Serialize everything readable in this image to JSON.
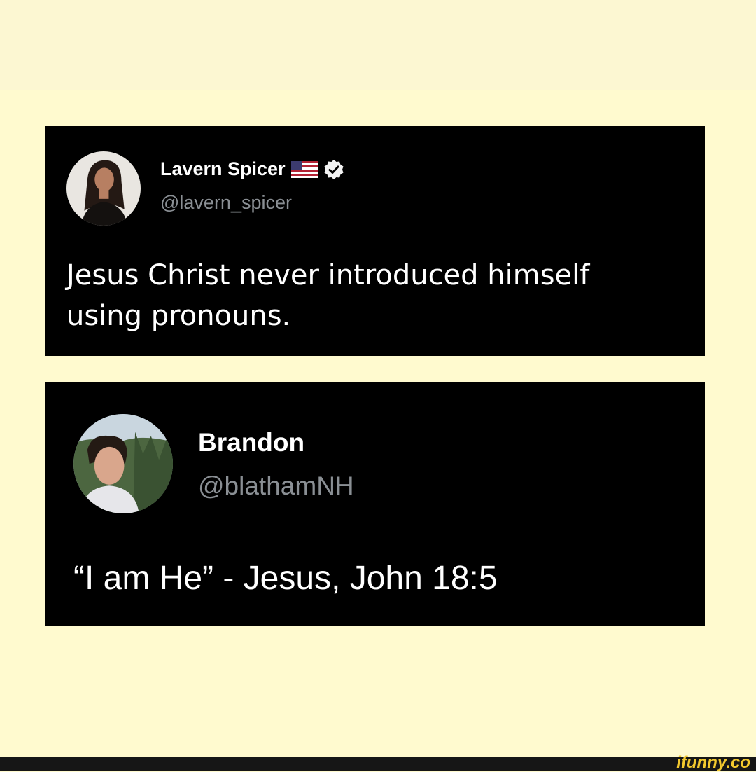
{
  "tweets": [
    {
      "display_name": "Lavern Spicer",
      "handle": "@lavern_spicer",
      "text": "Jesus Christ never introduced himself\nusing pronouns.",
      "has_flag": true,
      "verified": true
    },
    {
      "display_name": "Brandon",
      "handle": "@blathamNH",
      "text": "“I am He” - Jesus, John 18:5",
      "has_flag": false,
      "verified": false
    }
  ],
  "watermark": "ifunny.co",
  "colors": {
    "background": "#fffacf",
    "card": "#000000",
    "handle": "#8a8f94",
    "watermark": "#f2c82e"
  },
  "icons": {
    "flag": "us-flag-icon",
    "verified": "verified-badge-icon"
  }
}
